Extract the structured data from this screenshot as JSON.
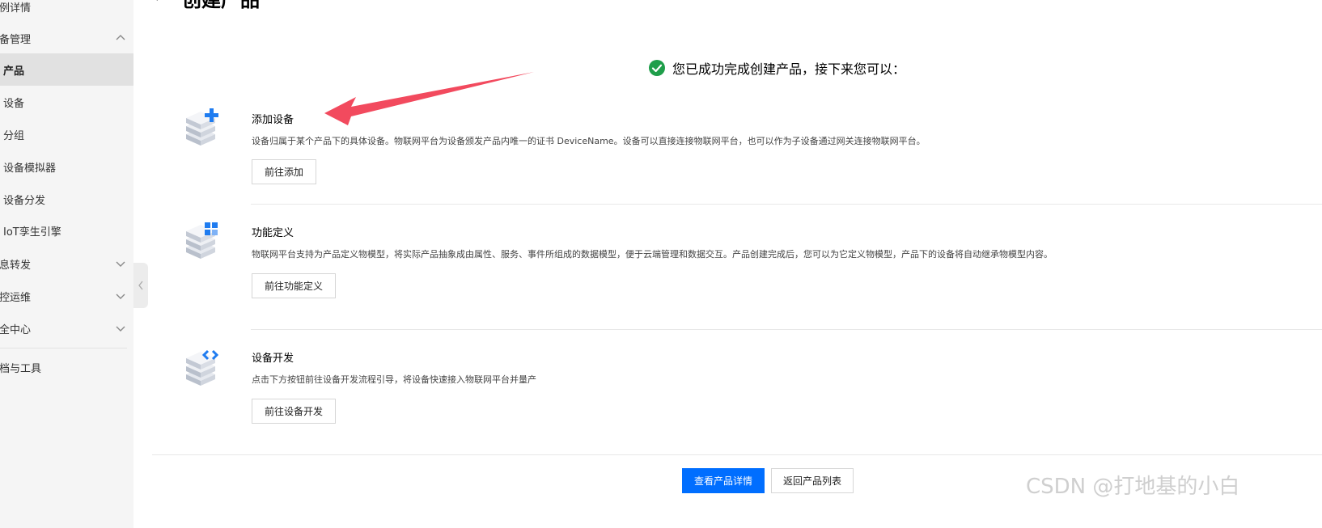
{
  "sidebar": {
    "items": [
      {
        "label": "例详情"
      },
      {
        "label": "备管理"
      },
      {
        "label": "产品"
      },
      {
        "label": "设备"
      },
      {
        "label": "分组"
      },
      {
        "label": "设备模拟器"
      },
      {
        "label": "设备分发"
      },
      {
        "label": "IoT孪生引擎"
      },
      {
        "label": "息转发"
      },
      {
        "label": "控运维"
      },
      {
        "label": "全中心"
      },
      {
        "label": "档与工具"
      }
    ],
    "active_index": 2
  },
  "header": {
    "title": "创建产品"
  },
  "success": {
    "message": "您已成功完成创建产品，接下来您可以："
  },
  "sections": [
    {
      "title": "添加设备",
      "description": "设备归属于某个产品下的具体设备。物联网平台为设备颁发产品内唯一的证书 DeviceName。设备可以直接连接物联网平台，也可以作为子设备通过网关连接物联网平台。",
      "button": "前往添加",
      "icon": "add-device-icon"
    },
    {
      "title": "功能定义",
      "description": "物联网平台支持为产品定义物模型，将实际产品抽象成由属性、服务、事件所组成的数据模型，便于云端管理和数据交互。产品创建完成后，您可以为它定义物模型，产品下的设备将自动继承物模型内容。",
      "button": "前往功能定义",
      "icon": "function-definition-icon"
    },
    {
      "title": "设备开发",
      "description": "点击下方按钮前往设备开发流程引导，将设备快速接入物联网平台并量产",
      "button": "前往设备开发",
      "icon": "device-development-icon"
    }
  ],
  "footer": {
    "primary_button": "查看产品详情",
    "secondary_button": "返回产品列表"
  },
  "watermark": "CSDN @打地基的小白",
  "colors": {
    "accent": "#006eff",
    "success": "#0abf5b",
    "annotation_arrow": "#f24a5e",
    "sidebar_bg": "#f5f5f5",
    "sidebar_active_bg": "#e1e1e1"
  }
}
